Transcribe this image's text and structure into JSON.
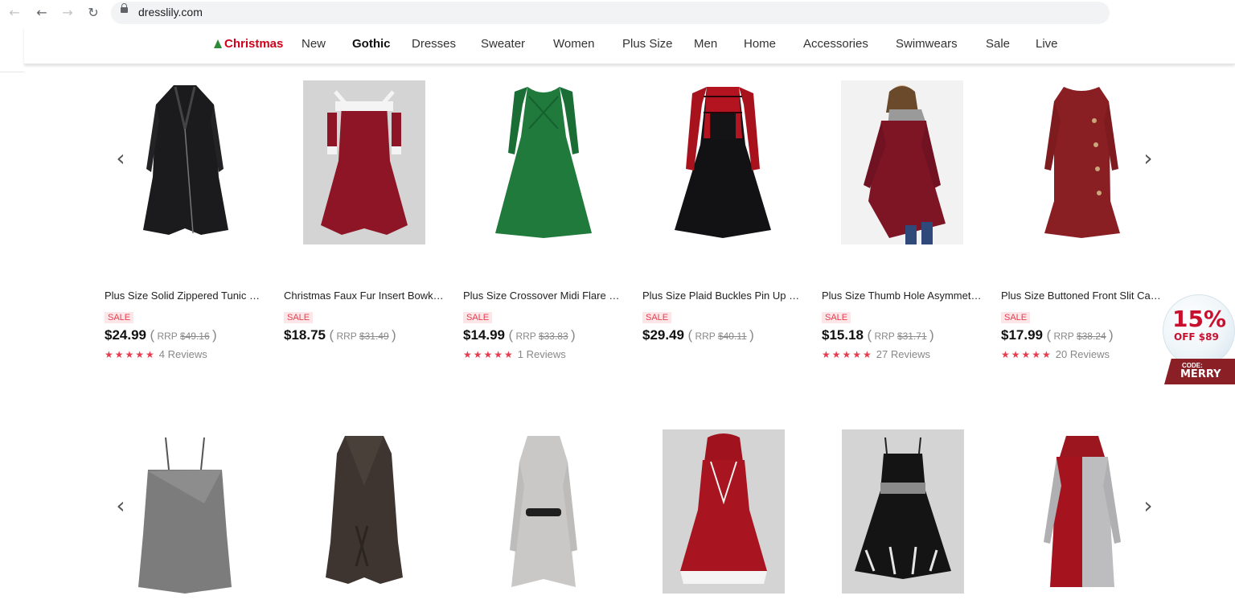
{
  "browser": {
    "url": "dresslily.com",
    "back_icon": "←",
    "forward_icon": "→",
    "reload_icon": "↻"
  },
  "nav": {
    "items": [
      "Christmas",
      "New",
      "Gothic",
      "Dresses",
      "Sweater",
      "Women",
      "Plus Size",
      "Men",
      "Home",
      "Accessories",
      "Swimwears",
      "Sale",
      "Live"
    ]
  },
  "carousel": {
    "prev_icon": "‹",
    "next_icon": "›"
  },
  "products_row1": [
    {
      "title": "Plus Size Solid Zippered Tunic Coat",
      "sale": "SALE",
      "price": "$24.99",
      "rrp_label": "RRP",
      "rrp": "$49.16",
      "stars": "★★★★★",
      "reviews": "4 Reviews"
    },
    {
      "title": "Christmas Faux Fur Insert Bowknot Dress",
      "sale": "SALE",
      "price": "$18.75",
      "rrp_label": "RRP",
      "rrp": "$31.49",
      "stars": "",
      "reviews": ""
    },
    {
      "title": "Plus Size Crossover Midi Flare Dress",
      "sale": "SALE",
      "price": "$14.99",
      "rrp_label": "RRP",
      "rrp": "$33.83",
      "stars": "★★★★★",
      "reviews": "1 Reviews"
    },
    {
      "title": "Plus Size Plaid Buckles Pin Up Dress",
      "sale": "SALE",
      "price": "$29.49",
      "rrp_label": "RRP",
      "rrp": "$40.11",
      "stars": "",
      "reviews": ""
    },
    {
      "title": "Plus Size Thumb Hole Asymmetric Tee",
      "sale": "SALE",
      "price": "$15.18",
      "rrp_label": "RRP",
      "rrp": "$31.71",
      "stars": "★★★★★",
      "reviews": "27 Reviews"
    },
    {
      "title": "Plus Size Buttoned Front Slit Cable Sweater",
      "sale": "SALE",
      "price": "$17.99",
      "rrp_label": "RRP",
      "rrp": "$38.24",
      "stars": "★★★★★",
      "reviews": "20 Reviews"
    }
  ],
  "coupon": {
    "percent": "15%",
    "off": "OFF $89",
    "code_label": "CODE:",
    "code": "MERRY"
  },
  "colors": {
    "accent_red": "#e73c4e",
    "christmas_red": "#d0021b"
  }
}
